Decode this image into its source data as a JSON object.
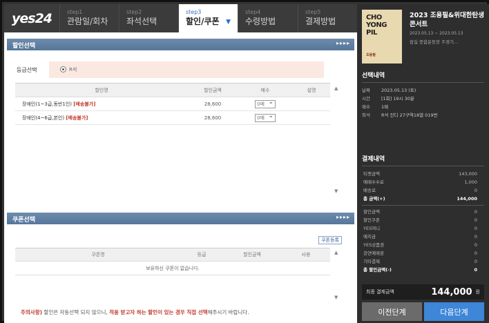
{
  "logo": "yes24",
  "steps": [
    {
      "num": "step1",
      "label": "관람일/회차",
      "active": false
    },
    {
      "num": "step2",
      "label": "좌석선택",
      "active": false
    },
    {
      "num": "step3",
      "label": "할인/쿠폰",
      "active": true
    },
    {
      "num": "step4",
      "label": "수령방법",
      "active": false
    },
    {
      "num": "step5",
      "label": "결제방법",
      "active": false
    }
  ],
  "discount": {
    "section_title": "할인선택",
    "arrows": "▸▸▸▸",
    "grade_label": "등급선택",
    "grade_value": "R석",
    "headers": [
      "할인명",
      "할인금액",
      "매수",
      "설명"
    ],
    "rows": [
      {
        "name": "장애인(1~3급,동반1인)",
        "tag": "[배송불가]",
        "amount": "28,600",
        "qty": "0매"
      },
      {
        "name": "장애인(4~6급,본인)",
        "tag": "[배송불가]",
        "amount": "28,600",
        "qty": "0매"
      }
    ]
  },
  "coupon": {
    "section_title": "쿠폰선택",
    "arrows": "▸▸▸▸",
    "register_label": "쿠폰등록",
    "headers": [
      "쿠폰명",
      "등급",
      "할인금액",
      "사용"
    ],
    "empty_text": "보유하신 쿠폰이 없습니다."
  },
  "notice": {
    "prefix": "주의사항)",
    "text1": " 할인은 자동선택 되지 않으니, ",
    "warn": "적용 받고자 하는 할인이 있는 경우 직접 선택",
    "text2": "해주시기 바랍니다."
  },
  "show": {
    "poster_line1": "CHO",
    "poster_line2": "YONG",
    "poster_line3": "PIL",
    "poster_sub": "조용필",
    "title": "2023 조용필&위대한탄생 콘서트",
    "period": "2023.05.13 ~ 2023.05.13",
    "venue": "잠실 종합운동장 주경기..."
  },
  "selection": {
    "title": "선택내역",
    "items": [
      {
        "k": "날짜",
        "v": "2023.05.13 (토)"
      },
      {
        "k": "시간",
        "v": "[1회] 19시 30분"
      },
      {
        "k": "매수",
        "v": "1매"
      },
      {
        "k": "좌석",
        "v": "R석 잔디 27구역18열 019번"
      }
    ]
  },
  "payment": {
    "title": "결제내역",
    "items": [
      {
        "k": "티켓금액",
        "v": "143,000"
      },
      {
        "k": "예매수수료",
        "v": "1,000"
      },
      {
        "k": "배송료",
        "v": "0"
      }
    ],
    "total": {
      "k": "총 금액(+)",
      "v": "144,000"
    },
    "discounts": [
      {
        "k": "할인금액",
        "v": "0"
      },
      {
        "k": "할인쿠폰",
        "v": "0"
      },
      {
        "k": "YES머니",
        "v": "0"
      },
      {
        "k": "예치금",
        "v": "0"
      },
      {
        "k": "YES상품권",
        "v": "0"
      },
      {
        "k": "공연예매권",
        "v": "0"
      },
      {
        "k": "기타결제",
        "v": "0"
      }
    ],
    "discount_total": {
      "k": "총 할인금액(-)",
      "v": "0"
    },
    "final_label": "최종 결제금액",
    "final_amount": "144,000",
    "final_unit": "원"
  },
  "buttons": {
    "prev": "이전단계",
    "next": "다음단계"
  },
  "colors": {
    "accent_blue": "#3d86d8",
    "warning_red": "#c0392b",
    "section_bar": "#607f9f",
    "grade_bg": "#fbe8e0"
  }
}
